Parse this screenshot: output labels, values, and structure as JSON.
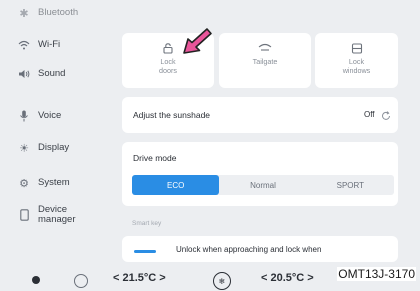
{
  "sidebar": {
    "items": [
      {
        "label": "Bluetooth",
        "icon": "bluetooth-icon"
      },
      {
        "label": "Wi-Fi",
        "icon": "wifi-icon"
      },
      {
        "label": "Sound",
        "icon": "speaker-icon"
      },
      {
        "label": "Voice",
        "icon": "microphone-icon"
      },
      {
        "label": "Display",
        "icon": "brightness-icon"
      },
      {
        "label": "System",
        "icon": "gear-icon"
      },
      {
        "label": "Device\nmanager",
        "icon": "phone-icon"
      }
    ]
  },
  "quick_actions": [
    {
      "label": "Lock\ndoors",
      "icon": "door-lock-icon"
    },
    {
      "label": "Tailgate",
      "icon": "tailgate-icon"
    },
    {
      "label": "Lock\nwindows",
      "icon": "window-lock-icon"
    }
  ],
  "sunshade": {
    "label": "Adjust the sunshade",
    "value": "Off"
  },
  "drive_mode": {
    "label": "Drive mode",
    "options": [
      "ECO",
      "Normal",
      "SPORT"
    ],
    "selected": "ECO"
  },
  "smart_key": {
    "section_label": "Smart key",
    "option_text": "Unlock when approaching and lock when"
  },
  "status_bar": {
    "left_temp": "< 21.5°C >",
    "right_temp": "< 20.5°C >"
  },
  "caption": "OMT13J-3170",
  "colors": {
    "accent": "#2a8de4",
    "arrow": "#e9559a",
    "background": "#eceef1"
  }
}
